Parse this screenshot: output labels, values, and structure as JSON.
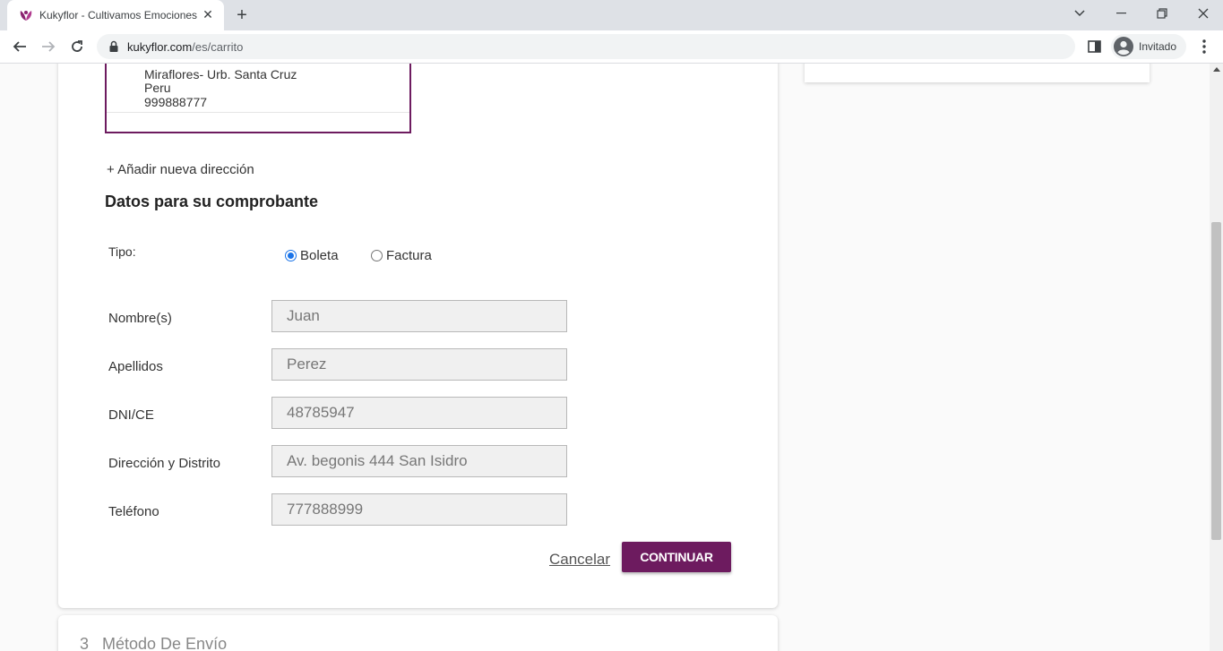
{
  "browser": {
    "tab_title": "Kukyflor - Cultivamos Emociones",
    "url_domain": "kukyflor.com",
    "url_path": "/es/carrito",
    "profile_name": "Invitado"
  },
  "address": {
    "line1": "Miraflores- Urb. Santa Cruz",
    "line2": "Peru",
    "line3": "999888777"
  },
  "add_address_label": "+ Añadir nueva dirección",
  "section_title": "Datos para su comprobante",
  "tipo": {
    "label": "Tipo:",
    "options": [
      "Boleta",
      "Factura"
    ],
    "selected": "Boleta"
  },
  "fields": [
    {
      "label": "Nombre(s)",
      "value": "Juan"
    },
    {
      "label": "Apellidos",
      "value": "Perez"
    },
    {
      "label": "DNI/CE",
      "value": "48785947"
    },
    {
      "label": "Dirección y Distrito",
      "value": "Av. begonis 444 San Isidro"
    },
    {
      "label": "Teléfono",
      "value": "777888999"
    }
  ],
  "actions": {
    "cancel": "Cancelar",
    "continue": "CONTINUAR"
  },
  "next_step": {
    "number": "3",
    "title": "Método De Envío"
  },
  "colors": {
    "brand": "#6d1b5f",
    "radio_selected": "#1a73e8"
  }
}
